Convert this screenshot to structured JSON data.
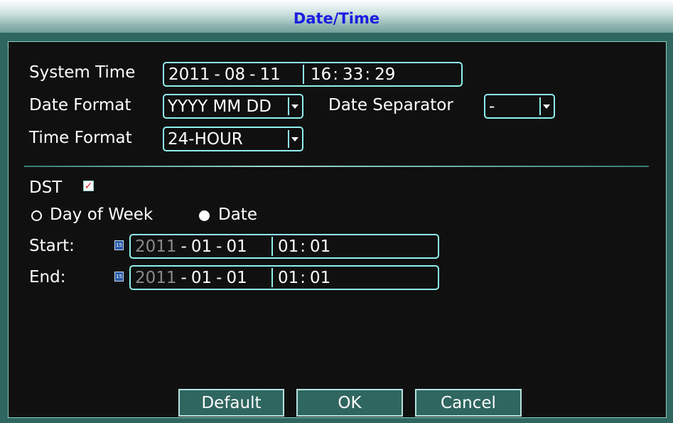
{
  "window": {
    "title": "Date/Time"
  },
  "system_time": {
    "label": "System Time",
    "date": {
      "year": "2011",
      "sep1": "-",
      "month": "08",
      "sep2": "-",
      "day": "11"
    },
    "time": {
      "hour": "16",
      "c1": ":",
      "minute": "33",
      "c2": ":",
      "second": "29"
    }
  },
  "date_format": {
    "label": "Date Format",
    "value": "YYYY MM DD"
  },
  "date_separator": {
    "label": "Date Separator",
    "value": "-"
  },
  "time_format": {
    "label": "Time Format",
    "value": "24-HOUR"
  },
  "dst": {
    "label": "DST",
    "checked": true,
    "check_glyph": "✓"
  },
  "dst_mode": {
    "options": [
      {
        "label": "Day of Week",
        "selected": false
      },
      {
        "label": "Date",
        "selected": true
      }
    ]
  },
  "start": {
    "label": "Start:",
    "calendar_icon": "calendar-icon",
    "calendar_text": "15",
    "year": "2011",
    "sep1": "-",
    "month": "01",
    "sep2": "-",
    "day": "01",
    "hour": "01",
    "colon": ":",
    "minute": "01"
  },
  "end": {
    "label": "End:",
    "calendar_icon": "calendar-icon",
    "calendar_text": "15",
    "year": "2011",
    "sep1": "-",
    "month": "01",
    "sep2": "-",
    "day": "01",
    "hour": "01",
    "colon": ":",
    "minute": "01"
  },
  "buttons": {
    "default": "Default",
    "ok": "OK",
    "cancel": "Cancel"
  },
  "colors": {
    "title_text": "#1a1ce0",
    "accent_border": "#8ff0ee",
    "panel_bg": "#101010",
    "frame_bg": "#2f6660"
  }
}
